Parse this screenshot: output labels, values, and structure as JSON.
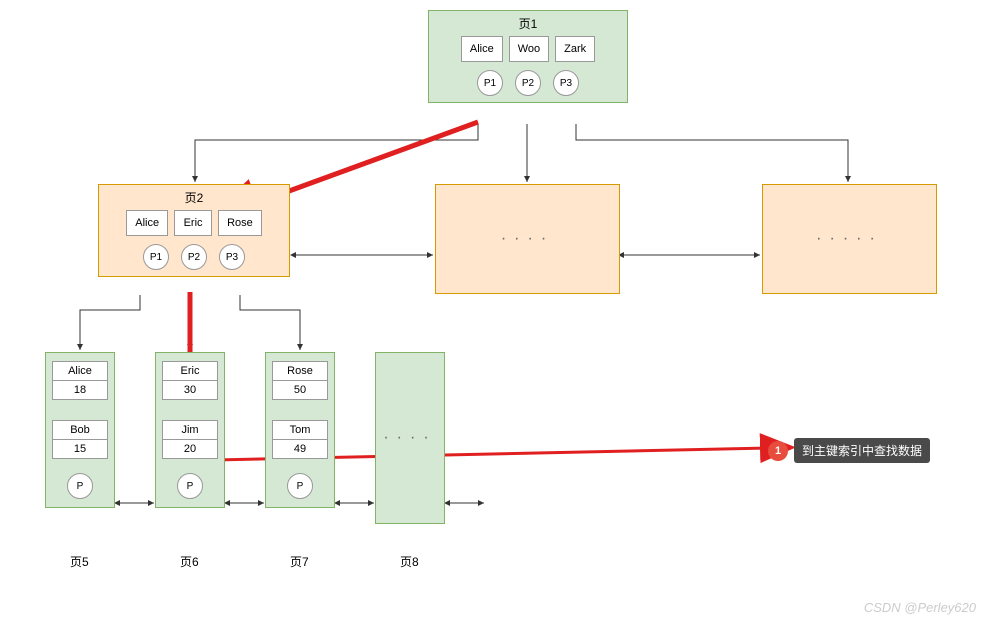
{
  "root": {
    "title": "页1",
    "keys": [
      "Alice",
      "Woo",
      "Zark"
    ],
    "ptrs": [
      "P1",
      "P2",
      "P3"
    ]
  },
  "level2": {
    "title": "页2",
    "keys": [
      "Alice",
      "Eric",
      "Rose"
    ],
    "ptrs": [
      "P1",
      "P2",
      "P3"
    ]
  },
  "placeholder_mid": "····",
  "placeholder_right": "·····",
  "leaves": [
    {
      "label": "页5",
      "records": [
        [
          "Alice",
          "18"
        ],
        [
          "Bob",
          "15"
        ]
      ],
      "ptr": "P"
    },
    {
      "label": "页6",
      "records": [
        [
          "Eric",
          "30"
        ],
        [
          "Jim",
          "20"
        ]
      ],
      "ptr": "P"
    },
    {
      "label": "页7",
      "records": [
        [
          "Rose",
          "50"
        ],
        [
          "Tom",
          "49"
        ]
      ],
      "ptr": "P"
    },
    {
      "label": "页8"
    }
  ],
  "leaf_ellipsis": "····",
  "annotation": {
    "num": "1",
    "text": "到主键索引中查找数据"
  },
  "watermark": "CSDN @Perley620"
}
